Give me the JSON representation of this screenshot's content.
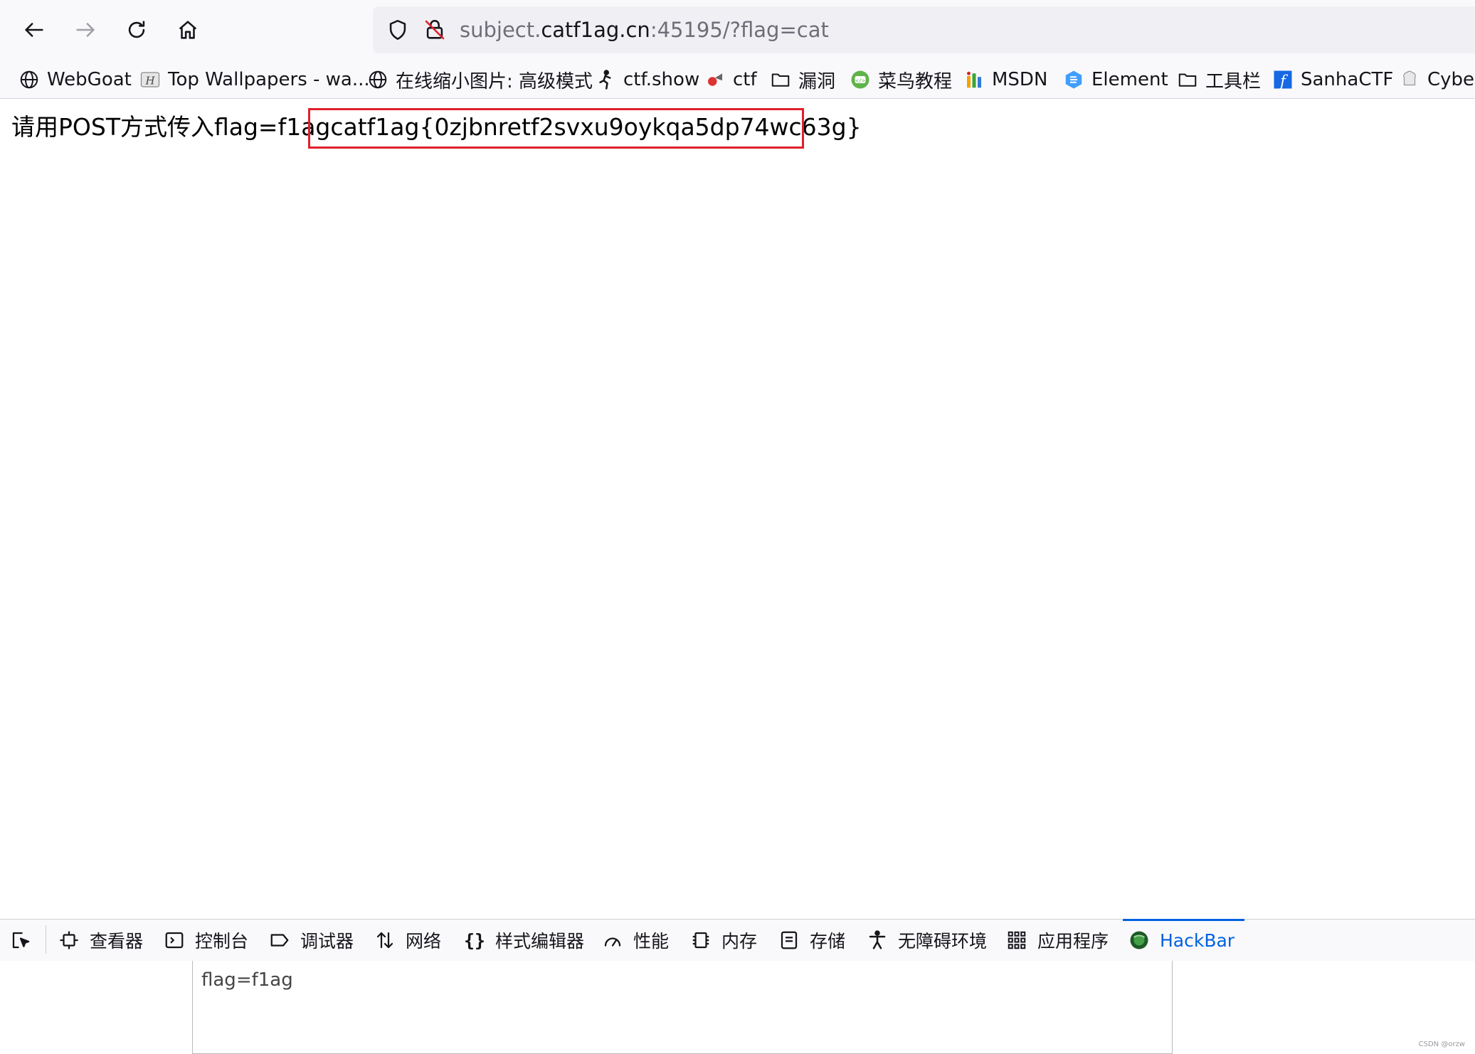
{
  "browser": {
    "url": {
      "prefix": "subject.",
      "host": "catf1ag.cn",
      "suffix": ":45195/?flag=cat"
    },
    "bookmarks": [
      {
        "label": "WebGoat",
        "icon": "globe-icon"
      },
      {
        "label": "Top Wallpapers - wa...",
        "icon": "wallpaper-icon"
      },
      {
        "label": "在线缩小图片: 高级模式",
        "icon": "globe-icon"
      },
      {
        "label": "ctf.show",
        "icon": "runner-icon"
      },
      {
        "label": "ctf",
        "icon": "ctf-icon"
      },
      {
        "label": "漏洞",
        "icon": "folder-icon"
      },
      {
        "label": "菜鸟教程",
        "icon": "runoob-icon"
      },
      {
        "label": "MSDN",
        "icon": "msdn-icon"
      },
      {
        "label": "Element",
        "icon": "element-icon"
      },
      {
        "label": "工具栏",
        "icon": "folder-icon"
      },
      {
        "label": "SanhaCTF",
        "icon": "sanha-icon"
      },
      {
        "label": "Cyber",
        "icon": "chef-icon"
      }
    ]
  },
  "page": {
    "prompt_text": "请用POST方式传入flag=f1ag",
    "flag_text": "catf1ag{0zjbnretf2svxu9oykqa5dp74wc63g}"
  },
  "devtools": {
    "tabs": [
      {
        "label": "查看器",
        "icon": "inspector-icon"
      },
      {
        "label": "控制台",
        "icon": "console-icon"
      },
      {
        "label": "调试器",
        "icon": "debugger-icon"
      },
      {
        "label": "网络",
        "icon": "network-icon"
      },
      {
        "label": "样式编辑器",
        "icon": "style-editor-icon"
      },
      {
        "label": "性能",
        "icon": "performance-icon"
      },
      {
        "label": "内存",
        "icon": "memory-icon"
      },
      {
        "label": "存储",
        "icon": "storage-icon"
      },
      {
        "label": "无障碍环境",
        "icon": "accessibility-icon"
      },
      {
        "label": "应用程序",
        "icon": "application-icon"
      },
      {
        "label": "HackBar",
        "icon": "hackbar-icon"
      }
    ],
    "active_tab": "HackBar",
    "hackbar": {
      "post_data": "flag=f1ag"
    }
  },
  "watermark": "CSDN @orzw",
  "colors": {
    "accent": "#0061e0",
    "highlight_border": "#e0202a"
  }
}
